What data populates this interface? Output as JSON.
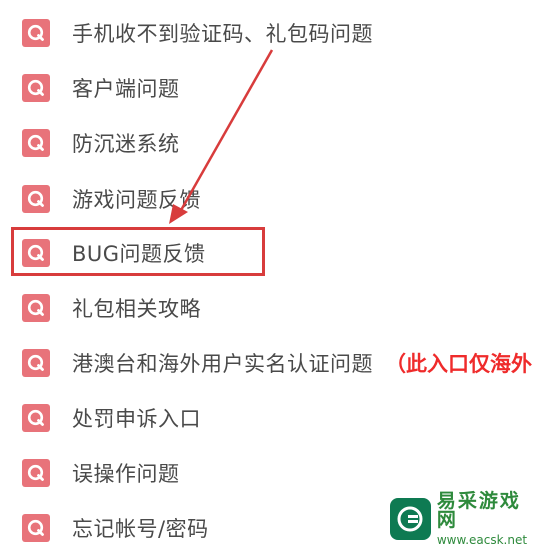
{
  "colors": {
    "icon_bg": "#e8737a",
    "text": "#4a4a4a",
    "note": "#ef2b2b",
    "highlight": "#d83c3c"
  },
  "faq": {
    "items": [
      {
        "label": "手机收不到验证码、礼包码问题",
        "icon": "q-icon"
      },
      {
        "label": "客户端问题",
        "icon": "q-icon"
      },
      {
        "label": "防沉迷系统",
        "icon": "q-icon"
      },
      {
        "label": "游戏问题反馈",
        "icon": "q-icon"
      },
      {
        "label": "BUG问题反馈",
        "icon": "q-icon"
      },
      {
        "label": "礼包相关攻略",
        "icon": "q-icon"
      },
      {
        "label": "港澳台和海外用户实名认证问题",
        "note": "（此入口仅海外",
        "icon": "q-icon"
      },
      {
        "label": "处罚申诉入口",
        "icon": "q-icon"
      },
      {
        "label": "误操作问题",
        "icon": "q-icon"
      },
      {
        "label": "忘记帐号/密码",
        "icon": "q-icon"
      }
    ]
  },
  "watermark": {
    "name": "易采游戏网",
    "url": "www.eacsk.net"
  }
}
